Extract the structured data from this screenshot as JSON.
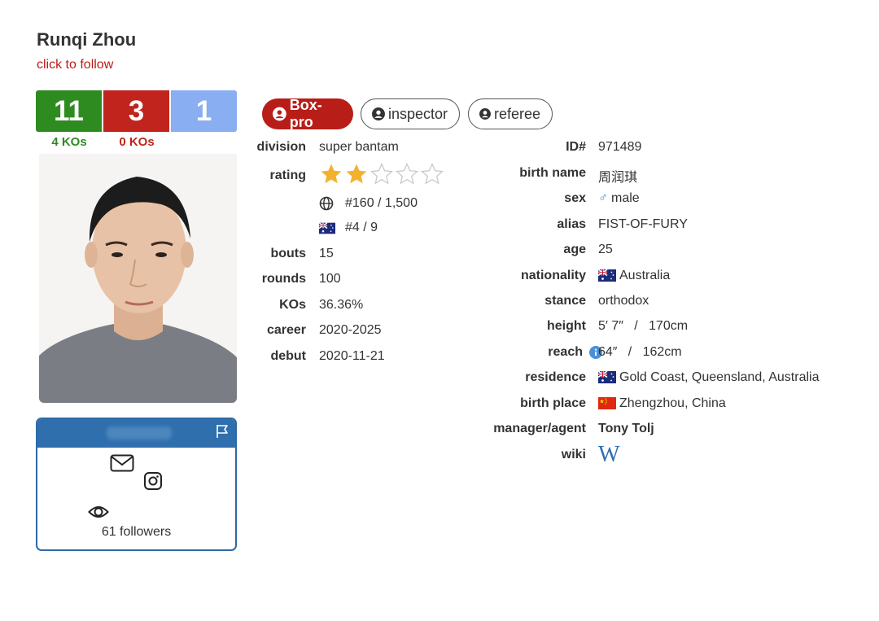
{
  "boxer": {
    "name": "Runqi Zhou",
    "follow_label": "click to follow"
  },
  "record": {
    "wins": "11",
    "losses": "3",
    "draws": "1",
    "win_kos": "4 KOs",
    "loss_kos": "0 KOs",
    "colors": {
      "win": "#2e8b20",
      "loss": "#c0241c",
      "draw": "#89aef2"
    }
  },
  "card": {
    "followers": "61 followers",
    "icons": [
      "flag-icon",
      "mail-icon",
      "instagram-icon",
      "eye-icon"
    ]
  },
  "pills": [
    {
      "label": "Box-pro",
      "active": true
    },
    {
      "label": "inspector",
      "active": false
    },
    {
      "label": "referee",
      "active": false
    }
  ],
  "left_stats": {
    "division_label": "division",
    "division": "super bantam",
    "rating_label": "rating",
    "rating_stars": 2,
    "rating_max": 5,
    "world_rank": "#160 / 1,500",
    "country_rank": "#4 / 9",
    "bouts_label": "bouts",
    "bouts": "15",
    "rounds_label": "rounds",
    "rounds": "100",
    "kos_label": "KOs",
    "kos": "36.36%",
    "career_label": "career",
    "career": "2020-2025",
    "debut_label": "debut",
    "debut": "2020-11-21"
  },
  "right_stats": {
    "id_label": "ID#",
    "id": "971489",
    "birth_name_label": "birth name",
    "birth_name": "周润琪",
    "sex_label": "sex",
    "sex_symbol": "♂",
    "sex": "male",
    "alias_label": "alias",
    "alias": "FIST-OF-FURY",
    "age_label": "age",
    "age": "25",
    "nationality_label": "nationality",
    "nationality": "Australia",
    "stance_label": "stance",
    "stance": "orthodox",
    "height_label": "height",
    "height": "5′ 7″   /   170cm",
    "reach_label": "reach",
    "reach": "64″   /   162cm",
    "residence_label": "residence",
    "residence": "Gold Coast, Queensland, Australia",
    "birth_place_label": "birth place",
    "birth_place": "Zhengzhou, China",
    "manager_label": "manager/agent",
    "manager": "Tony Tolj",
    "wiki_label": "wiki",
    "wiki_glyph": "W"
  },
  "colors": {
    "accent_red": "#b81d18",
    "card_blue": "#2f6fae",
    "star_gold": "#f2b230"
  }
}
